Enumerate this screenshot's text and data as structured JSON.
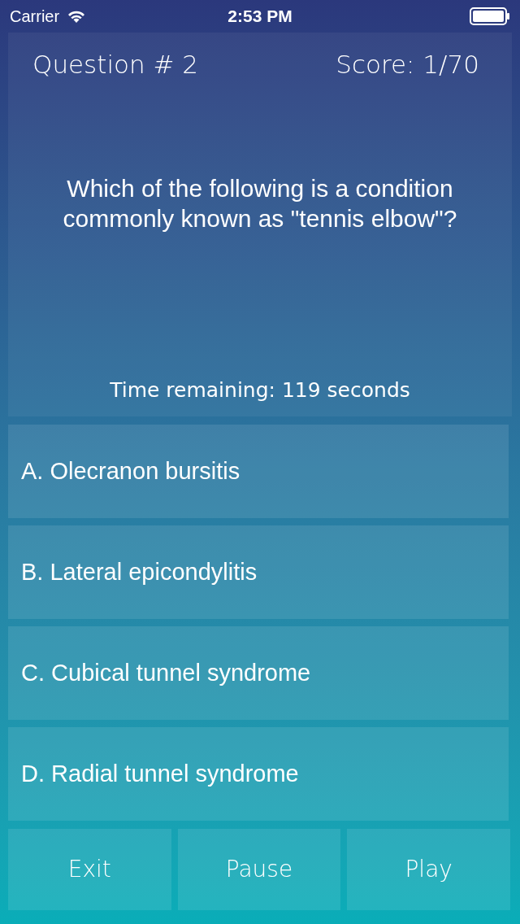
{
  "status_bar": {
    "carrier": "Carrier",
    "time": "2:53 PM"
  },
  "header": {
    "question_number": "Question # 2",
    "score": "Score: 1/70"
  },
  "question": "Which of the following is a condition commonly known as \"tennis elbow\"?",
  "timer": "Time remaining: 119 seconds",
  "answers": [
    {
      "label": "A. Olecranon bursitis"
    },
    {
      "label": "B. Lateral epicondylitis"
    },
    {
      "label": "C. Cubical tunnel syndrome"
    },
    {
      "label": "D. Radial tunnel syndrome"
    }
  ],
  "buttons": [
    {
      "label": "Exit"
    },
    {
      "label": "Pause"
    },
    {
      "label": "Play"
    }
  ]
}
